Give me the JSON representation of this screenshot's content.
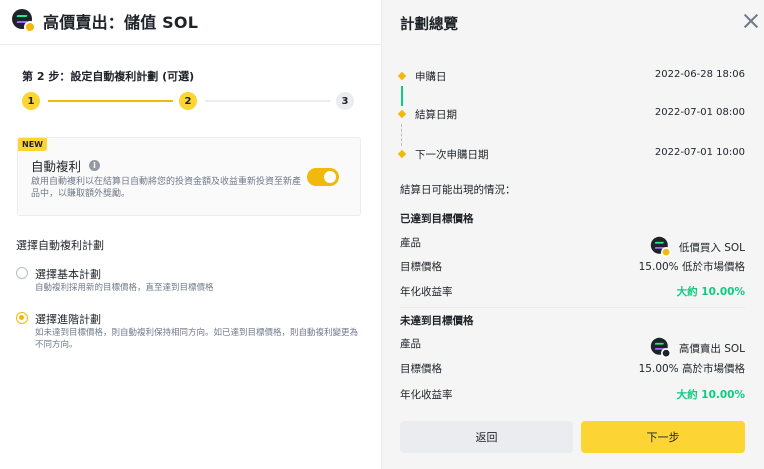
{
  "header": {
    "title": "高價賣出：儲值 SOL"
  },
  "steps": {
    "label": "第 2 步：設定自動複利計劃 (可選)",
    "items": [
      "1",
      "2",
      "3"
    ],
    "current": 2,
    "total": 3
  },
  "auto_compound": {
    "badge": "NEW",
    "title": "自動複利",
    "info_icon": "i",
    "desc": "啟用自動複利以在結算日自動將您的投資金額及收益重新投資至新產品中，以賺取額外獎勵。",
    "enabled": true
  },
  "plan": {
    "label": "選擇自動複利計劃",
    "options": [
      {
        "title": "選擇基本計劃",
        "desc": "自動複利採用新的目標價格，直至達到目標價格",
        "selected": false
      },
      {
        "title": "選擇進階計劃",
        "desc": "如未達到目標價格，則自動複利保持相同方向。如已達到目標價格，則自動複利變更為不同方向。",
        "selected": true
      }
    ]
  },
  "overview": {
    "title": "計劃總覽",
    "timeline": [
      {
        "label": "申購日",
        "value": "2022-06-28 18:06"
      },
      {
        "label": "結算日期",
        "value": "2022-07-01 08:00"
      },
      {
        "label": "下一次申購日期",
        "value": "2022-07-01 10:00"
      }
    ],
    "possible": "結算日可能出現的情況：",
    "reached": {
      "title": "已達到目標價格",
      "rows": [
        {
          "k": "產品",
          "v": "低價買入 SOL"
        },
        {
          "k": "目標價格",
          "v": "15.00% 低於市場價格"
        },
        {
          "k": "年化收益率",
          "v": "大約 10.00%"
        }
      ]
    },
    "not_reached": {
      "title": "未達到目標價格",
      "rows": [
        {
          "k": "產品",
          "v": "高價賣出 SOL"
        },
        {
          "k": "目標價格",
          "v": "15.00% 高於市場價格"
        },
        {
          "k": "年化收益率",
          "v": "大約 10.00%"
        }
      ]
    }
  },
  "buttons": {
    "back": "返回",
    "next": "下一步"
  },
  "colors": {
    "accent": "#fcd535",
    "accent_dark": "#f0b90b",
    "positive": "#0ecb81",
    "text": "#1e2329",
    "muted": "#707a8a"
  }
}
